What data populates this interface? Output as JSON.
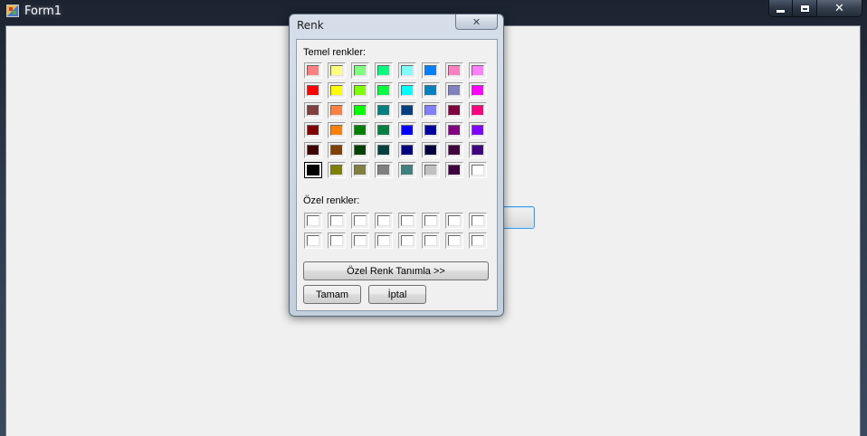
{
  "window": {
    "title": "Form1",
    "icon": "winforms-app-icon"
  },
  "caption_buttons": {
    "minimize_icon": "minimize-icon",
    "maximize_icon": "maximize-icon",
    "close_symbol": "✕"
  },
  "dialog": {
    "title": "Renk",
    "close_symbol": "✕",
    "basic_colors_label": "Temel renkler:",
    "custom_colors_label": "Özel renkler:",
    "basic_colors": [
      "#FF8080",
      "#FFFF80",
      "#80FF80",
      "#00FF80",
      "#80FFFF",
      "#0080FF",
      "#FF80C0",
      "#FF80FF",
      "#FF0000",
      "#FFFF00",
      "#80FF00",
      "#00FF40",
      "#00FFFF",
      "#0080C0",
      "#8080C0",
      "#FF00FF",
      "#804040",
      "#FF8040",
      "#00FF00",
      "#008080",
      "#004080",
      "#8080FF",
      "#800040",
      "#FF0080",
      "#800000",
      "#FF8000",
      "#008000",
      "#008040",
      "#0000FF",
      "#0000A0",
      "#800080",
      "#8000FF",
      "#400000",
      "#804000",
      "#004000",
      "#004040",
      "#000080",
      "#000040",
      "#400040",
      "#400080",
      "#000000",
      "#808000",
      "#808040",
      "#808080",
      "#408080",
      "#C0C0C0",
      "#400040",
      "#FFFFFF"
    ],
    "selected_basic_index": 40,
    "custom_colors": [
      "#FFFFFF",
      "#FFFFFF",
      "#FFFFFF",
      "#FFFFFF",
      "#FFFFFF",
      "#FFFFFF",
      "#FFFFFF",
      "#FFFFFF",
      "#FFFFFF",
      "#FFFFFF",
      "#FFFFFF",
      "#FFFFFF",
      "#FFFFFF",
      "#FFFFFF",
      "#FFFFFF",
      "#FFFFFF"
    ],
    "define_custom_label": "Özel Renk Tanımla >>",
    "ok_label": "Tamam",
    "cancel_label": "İptal"
  },
  "form": {
    "button_label": ""
  }
}
